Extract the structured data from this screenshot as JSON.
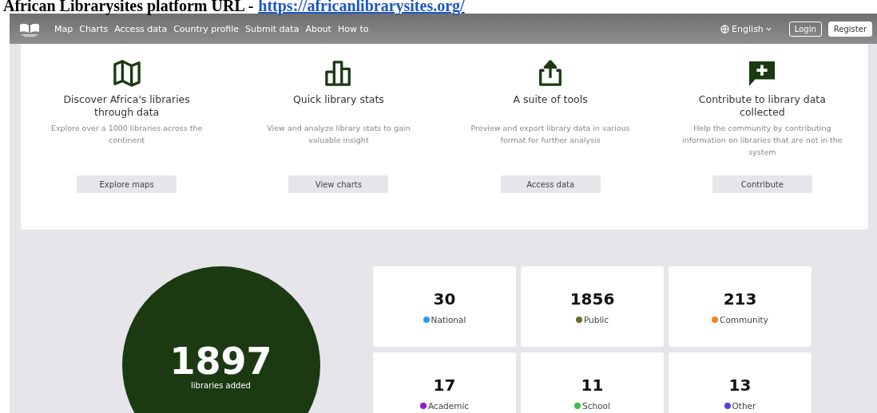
{
  "caption": {
    "text": "African Librarysites platform URL - ",
    "link": "https://africanlibrarysites.org/"
  },
  "nav": {
    "links": [
      "Map",
      "Charts",
      "Access data",
      "Country profile",
      "Submit data",
      "About",
      "How to"
    ],
    "language": "English",
    "login": "Login",
    "register": "Register"
  },
  "features": [
    {
      "kind": "map",
      "title": "Discover Africa's libraries through data",
      "description": "Explore over a 1000 libraries across the continent",
      "button": "Explore maps"
    },
    {
      "kind": "chart",
      "title": "Quick library stats",
      "description": "View and analyze library stats to gain valuable insight",
      "button": "View charts"
    },
    {
      "kind": "export",
      "title": "A suite of tools",
      "description": "Preview and export library data in various format for further analysis",
      "button": "Access data"
    },
    {
      "kind": "add",
      "title": "Contribute to library data collected",
      "description": "Help the community by contributing information on libraries that are not in the system",
      "button": "Contribute"
    }
  ],
  "total": {
    "value": "1897",
    "label": "libraries added"
  },
  "stats": [
    {
      "value": "30",
      "label": "National",
      "color": "#2f9be8"
    },
    {
      "value": "1856",
      "label": "Public",
      "color": "#6b6a2c"
    },
    {
      "value": "213",
      "label": "Community",
      "color": "#ee8526"
    },
    {
      "value": "17",
      "label": "Academic",
      "color": "#8a1fc9"
    },
    {
      "value": "11",
      "label": "School",
      "color": "#3cbf45"
    },
    {
      "value": "13",
      "label": "Other",
      "color": "#5a3fd6"
    }
  ]
}
